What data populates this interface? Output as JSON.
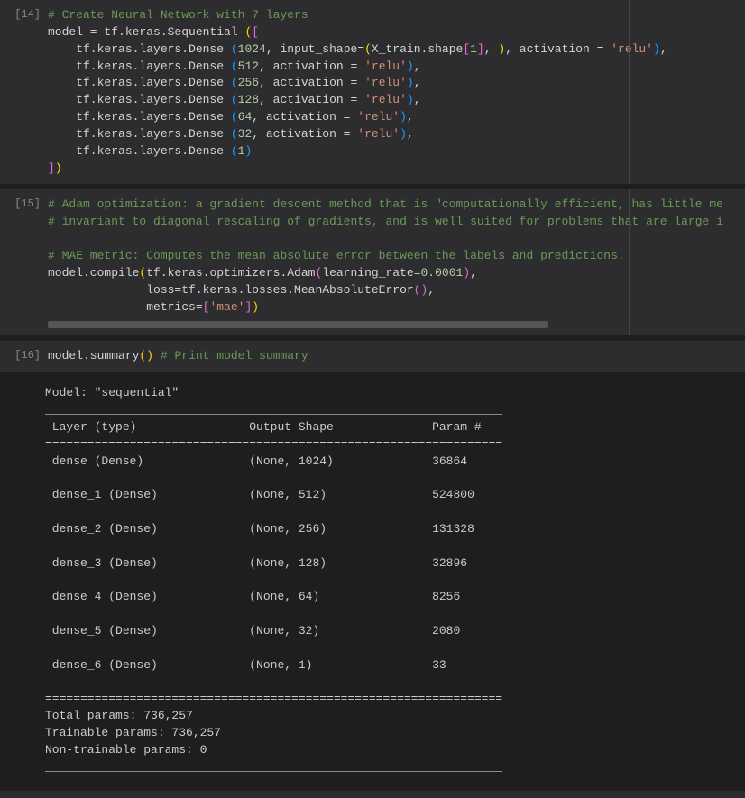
{
  "cells": [
    {
      "prompt": "[14]",
      "lines": [
        [
          {
            "t": "# Create Neural Network with 7 layers",
            "c": "c-comment"
          }
        ],
        [
          {
            "t": "model = tf.keras.Sequential "
          },
          {
            "t": "(",
            "c": "c-paren-y"
          },
          {
            "t": "[",
            "c": "c-paren-p"
          }
        ],
        [
          {
            "t": "    tf.keras.layers.Dense "
          },
          {
            "t": "(",
            "c": "c-paren-b"
          },
          {
            "t": "1024",
            "c": "c-num"
          },
          {
            "t": ", input_shape="
          },
          {
            "t": "(",
            "c": "c-paren-y"
          },
          {
            "t": "X_train.shape"
          },
          {
            "t": "[",
            "c": "c-paren-p"
          },
          {
            "t": "1",
            "c": "c-num"
          },
          {
            "t": "]",
            "c": "c-paren-p"
          },
          {
            "t": ", "
          },
          {
            "t": ")",
            "c": "c-paren-y"
          },
          {
            "t": ", activation = "
          },
          {
            "t": "'relu'",
            "c": "c-str"
          },
          {
            "t": ")",
            "c": "c-paren-b"
          },
          {
            "t": ","
          }
        ],
        [
          {
            "t": "    tf.keras.layers.Dense "
          },
          {
            "t": "(",
            "c": "c-paren-b"
          },
          {
            "t": "512",
            "c": "c-num"
          },
          {
            "t": ", activation = "
          },
          {
            "t": "'relu'",
            "c": "c-str"
          },
          {
            "t": ")",
            "c": "c-paren-b"
          },
          {
            "t": ","
          }
        ],
        [
          {
            "t": "    tf.keras.layers.Dense "
          },
          {
            "t": "(",
            "c": "c-paren-b"
          },
          {
            "t": "256",
            "c": "c-num"
          },
          {
            "t": ", activation = "
          },
          {
            "t": "'relu'",
            "c": "c-str"
          },
          {
            "t": ")",
            "c": "c-paren-b"
          },
          {
            "t": ","
          }
        ],
        [
          {
            "t": "    tf.keras.layers.Dense "
          },
          {
            "t": "(",
            "c": "c-paren-b"
          },
          {
            "t": "128",
            "c": "c-num"
          },
          {
            "t": ", activation = "
          },
          {
            "t": "'relu'",
            "c": "c-str"
          },
          {
            "t": ")",
            "c": "c-paren-b"
          },
          {
            "t": ","
          }
        ],
        [
          {
            "t": "    tf.keras.layers.Dense "
          },
          {
            "t": "(",
            "c": "c-paren-b"
          },
          {
            "t": "64",
            "c": "c-num"
          },
          {
            "t": ", activation = "
          },
          {
            "t": "'relu'",
            "c": "c-str"
          },
          {
            "t": ")",
            "c": "c-paren-b"
          },
          {
            "t": ","
          }
        ],
        [
          {
            "t": "    tf.keras.layers.Dense "
          },
          {
            "t": "(",
            "c": "c-paren-b"
          },
          {
            "t": "32",
            "c": "c-num"
          },
          {
            "t": ", activation = "
          },
          {
            "t": "'relu'",
            "c": "c-str"
          },
          {
            "t": ")",
            "c": "c-paren-b"
          },
          {
            "t": ","
          }
        ],
        [
          {
            "t": "    tf.keras.layers.Dense "
          },
          {
            "t": "(",
            "c": "c-paren-b"
          },
          {
            "t": "1",
            "c": "c-num"
          },
          {
            "t": ")",
            "c": "c-paren-b"
          }
        ],
        [
          {
            "t": "]",
            "c": "c-paren-p"
          },
          {
            "t": ")",
            "c": "c-paren-y"
          }
        ]
      ]
    },
    {
      "prompt": "[15]",
      "lines": [
        [
          {
            "t": "# Adam optimization: a gradient descent method that is \"computationally efficient, has little me",
            "c": "c-comment"
          }
        ],
        [
          {
            "t": "# invariant to diagonal rescaling of gradients, and is well suited for problems that are large i",
            "c": "c-comment"
          }
        ],
        [
          {
            "t": ""
          }
        ],
        [
          {
            "t": "# MAE metric: Computes the mean absolute error between the labels and predictions.",
            "c": "c-comment"
          }
        ],
        [
          {
            "t": "model.compile"
          },
          {
            "t": "(",
            "c": "c-paren-y"
          },
          {
            "t": "tf.keras.optimizers.Adam"
          },
          {
            "t": "(",
            "c": "c-paren-p"
          },
          {
            "t": "learning_rate="
          },
          {
            "t": "0.0001",
            "c": "c-num"
          },
          {
            "t": ")",
            "c": "c-paren-p"
          },
          {
            "t": ","
          }
        ],
        [
          {
            "t": "              loss=tf.keras.losses.MeanAbsoluteError"
          },
          {
            "t": "(",
            "c": "c-paren-p"
          },
          {
            "t": ")",
            "c": "c-paren-p"
          },
          {
            "t": ","
          }
        ],
        [
          {
            "t": "              metrics="
          },
          {
            "t": "[",
            "c": "c-paren-p"
          },
          {
            "t": "'mae'",
            "c": "c-str"
          },
          {
            "t": "]",
            "c": "c-paren-p"
          },
          {
            "t": ")",
            "c": "c-paren-y"
          }
        ]
      ],
      "hscroll": true
    },
    {
      "prompt": "[16]",
      "lines": [
        [
          {
            "t": "model.summary"
          },
          {
            "t": "(",
            "c": "c-paren-y"
          },
          {
            "t": ")",
            "c": "c-paren-y"
          },
          {
            "t": " "
          },
          {
            "t": "# Print model summary",
            "c": "c-comment"
          }
        ]
      ]
    }
  ],
  "output16": "Model: \"sequential\"\n_________________________________________________________________\n Layer (type)                Output Shape              Param #   \n=================================================================\n dense (Dense)               (None, 1024)              36864     \n                                                                 \n dense_1 (Dense)             (None, 512)               524800    \n                                                                 \n dense_2 (Dense)             (None, 256)               131328    \n                                                                 \n dense_3 (Dense)             (None, 128)               32896     \n                                                                 \n dense_4 (Dense)             (None, 64)                8256      \n                                                                 \n dense_5 (Dense)             (None, 32)                2080      \n                                                                 \n dense_6 (Dense)             (None, 1)                 33        \n                                                                 \n=================================================================\nTotal params: 736,257\nTrainable params: 736,257\nNon-trainable params: 0\n_________________________________________________________________"
}
